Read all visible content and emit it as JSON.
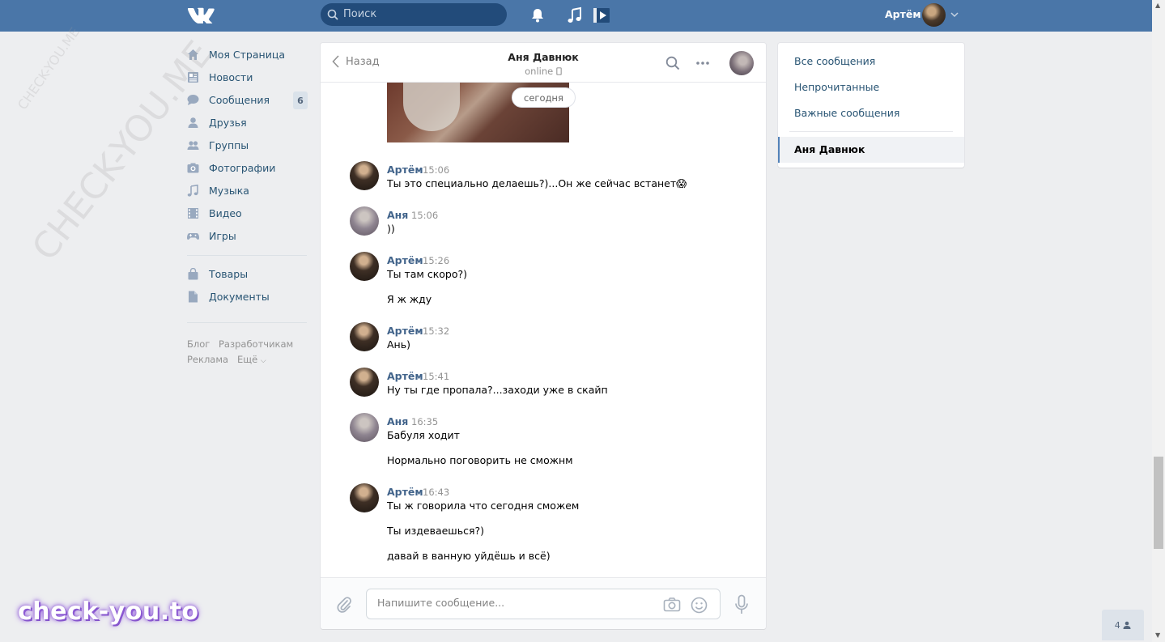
{
  "header": {
    "search_placeholder": "Поиск",
    "user_name": "Артём"
  },
  "nav": {
    "items": [
      {
        "label": "Моя Страница",
        "icon": "home-icon"
      },
      {
        "label": "Новости",
        "icon": "news-icon"
      },
      {
        "label": "Сообщения",
        "icon": "messages-icon",
        "badge": "6"
      },
      {
        "label": "Друзья",
        "icon": "friends-icon"
      },
      {
        "label": "Группы",
        "icon": "groups-icon"
      },
      {
        "label": "Фотографии",
        "icon": "photos-icon"
      },
      {
        "label": "Музыка",
        "icon": "music-icon"
      },
      {
        "label": "Видео",
        "icon": "video-icon"
      },
      {
        "label": "Игры",
        "icon": "games-icon"
      }
    ],
    "extra_items": [
      {
        "label": "Товары",
        "icon": "market-icon"
      },
      {
        "label": "Документы",
        "icon": "documents-icon"
      }
    ],
    "footer": {
      "blog": "Блог",
      "developers": "Разработчикам",
      "ads": "Реклама",
      "more": "Ещё"
    }
  },
  "chat": {
    "back_label": "Назад",
    "title": "Аня Давнюк",
    "status": "online",
    "date_label": "сегодня",
    "messages": [
      {
        "author": "Артём",
        "time": "15:06",
        "lines": [
          "Ты это специально делаешь?)...Он же сейчас встанет😱"
        ]
      },
      {
        "author": "Аня",
        "time": "15:06",
        "lines": [
          "))"
        ]
      },
      {
        "author": "Артём",
        "time": "15:26",
        "lines": [
          "Ты там скоро?)",
          "Я ж жду"
        ]
      },
      {
        "author": "Артём",
        "time": "15:32",
        "lines": [
          "Ань)"
        ]
      },
      {
        "author": "Артём",
        "time": "15:41",
        "lines": [
          "Ну ты где пропала?...заходи уже в скайп"
        ]
      },
      {
        "author": "Аня",
        "time": "16:35",
        "lines": [
          "Бабуля ходит",
          "Нормально поговорить не сможнм"
        ]
      },
      {
        "author": "Артём",
        "time": "16:43",
        "lines": [
          "Ты ж говорила что сегодня сможем",
          "Ты издеваешься?)",
          "давай в ванную уйдёшь и всё)"
        ]
      }
    ],
    "composer_placeholder": "Напишите сообщение..."
  },
  "right_menu": {
    "items": [
      "Все сообщения",
      "Непрочитанные",
      "Важные сообщения"
    ],
    "active": "Аня Давнюк"
  },
  "friends_online_count": "4",
  "watermarks": {
    "diagonal": "CHECK-YOU.ME",
    "badge": "check-you.to"
  },
  "colors": {
    "accent": "#4a76a8",
    "link": "#285473",
    "author": "#42648b"
  }
}
